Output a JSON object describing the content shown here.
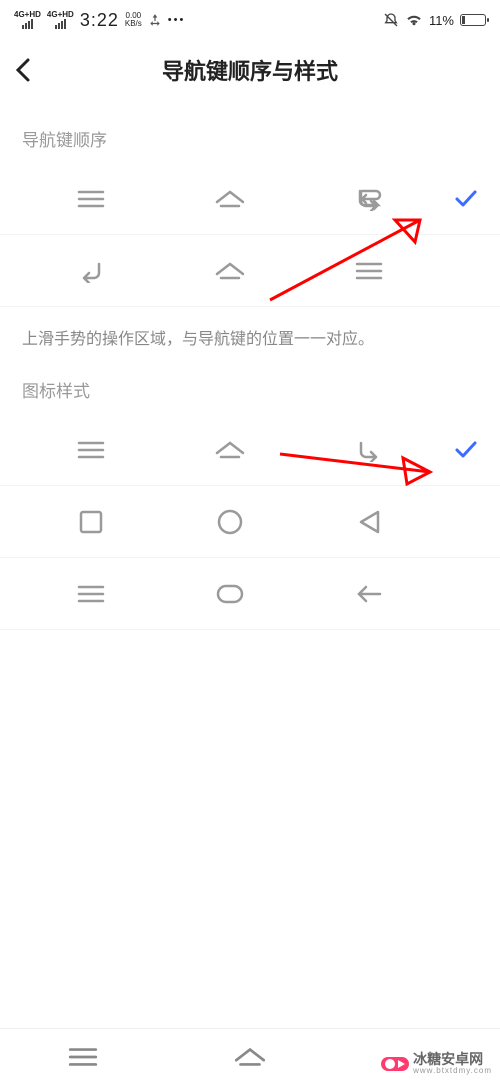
{
  "status": {
    "net1": "4G+HD",
    "net2": "4G+HD",
    "time": "3:22",
    "speed_top": "0.00",
    "speed_bot": "KB/s",
    "battery_pct": "11%",
    "battery_fill": 11
  },
  "header": {
    "title": "导航键顺序与样式"
  },
  "sections": {
    "order_label": "导航键顺序",
    "order_hint": "上滑手势的操作区域，与导航键的位置一一对应。",
    "style_label": "图标样式"
  },
  "icons": {
    "menu": "menu",
    "home": "home",
    "back": "back",
    "square": "square",
    "circle": "circle",
    "triangle": "triangle",
    "pill": "pill",
    "arrow": "arrow"
  },
  "rows": {
    "order": [
      {
        "layout": [
          "menu",
          "home",
          "back"
        ],
        "selected": true
      },
      {
        "layout": [
          "back",
          "home",
          "menu"
        ],
        "selected": false
      }
    ],
    "style": [
      {
        "layout": [
          "menu",
          "home",
          "back"
        ],
        "selected": true
      },
      {
        "layout": [
          "square",
          "circle",
          "triangle"
        ],
        "selected": false
      },
      {
        "layout": [
          "menu",
          "pill",
          "arrow"
        ],
        "selected": false
      }
    ]
  },
  "watermark": {
    "text": "冰糖安卓网",
    "sub": "www.btxtdmy.com"
  },
  "colors": {
    "accent": "#3b6bff",
    "arrow": "#ff0000",
    "muted": "#9a9a9a"
  }
}
